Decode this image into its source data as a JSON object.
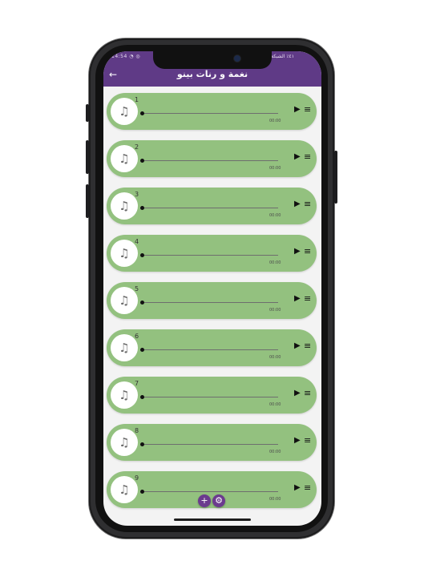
{
  "status": {
    "left": "14:54 ◔ ◎",
    "right": "٤١٪ الشبكة"
  },
  "header": {
    "back_icon": "←",
    "title": "نغمة و رنات بينو"
  },
  "rows": [
    {
      "number": "1",
      "time": "00:00"
    },
    {
      "number": "2",
      "time": "00:00"
    },
    {
      "number": "3",
      "time": "00:00"
    },
    {
      "number": "4",
      "time": "00:00"
    },
    {
      "number": "5",
      "time": "00:00"
    },
    {
      "number": "6",
      "time": "00:00"
    },
    {
      "number": "7",
      "time": "00:00"
    },
    {
      "number": "8",
      "time": "00:00"
    },
    {
      "number": "9",
      "time": "00:00"
    }
  ],
  "icons": {
    "music": "♫",
    "play": "▶",
    "menu": "≡",
    "plus": "+",
    "settings": "⚙"
  },
  "colors": {
    "appbar": "#5f3a86",
    "row": "#93c17f",
    "fab": "#6b3b8e"
  }
}
